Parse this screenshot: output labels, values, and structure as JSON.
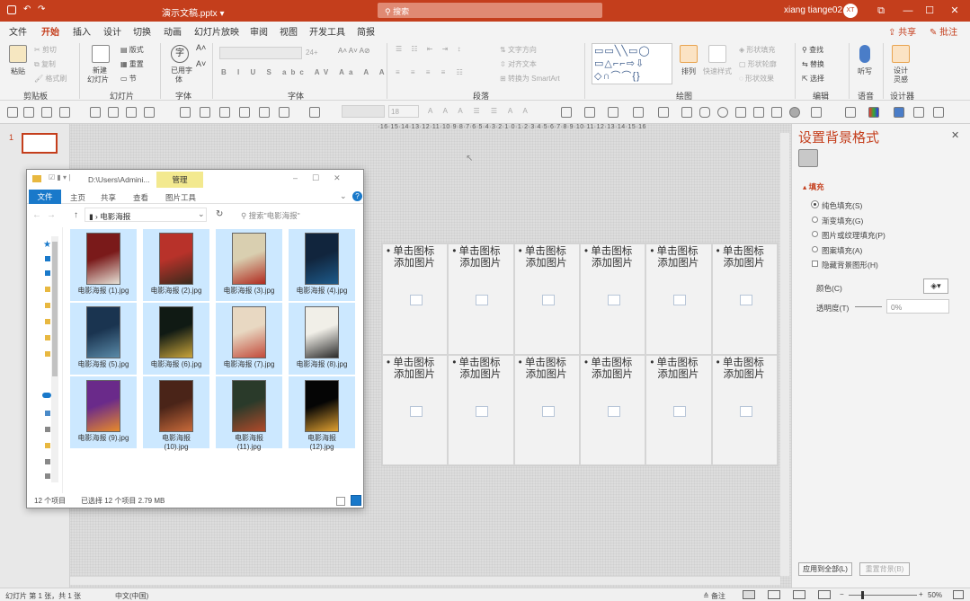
{
  "titlebar": {
    "doc_title": "演示文稿.pptx  ▾",
    "search": "搜索",
    "user": "xiang tiange02",
    "avatar": "XT",
    "min": "—",
    "max": "☐",
    "close": "✕",
    "restore": "⧉"
  },
  "tabs": [
    "文件",
    "开始",
    "插入",
    "设计",
    "切换",
    "动画",
    "幻灯片放映",
    "审阅",
    "视图",
    "开发工具",
    "简报"
  ],
  "tabs_active": "开始",
  "share": "共享",
  "comment": "批注",
  "ribbon": {
    "clipboard": {
      "label": "剪贴板",
      "paste": "粘贴",
      "cut": "剪切",
      "copy": "复制",
      "painter": "格式刷"
    },
    "slides": {
      "label": "幻灯片",
      "new": "新建",
      "new2": "幻灯片",
      "layout": "版式",
      "reset": "重置",
      "section": "节"
    },
    "font_grp": {
      "label": "字体",
      "used": "已用字",
      "used2": "体",
      "char": "字"
    },
    "font": {
      "label": "字体",
      "size": "24+"
    },
    "paragraph": {
      "label": "段落",
      "direction": "文字方向",
      "align": "对齐文本",
      "smartart": "转换为 SmartArt"
    },
    "drawing": {
      "label": "绘图",
      "arrange": "排列",
      "quick": "快速样式",
      "fill": "形状填充",
      "outline": "形状轮廓",
      "effect": "形状效果"
    },
    "editing": {
      "label": "编辑",
      "find": "查找",
      "replace": "替换",
      "select": "选择"
    },
    "voice": {
      "label": "语音",
      "dictate": "听写"
    },
    "designer": {
      "label": "设计器",
      "idea": "设计",
      "idea2": "灵感"
    }
  },
  "toolbar2": {
    "fontsize": "18"
  },
  "slide": {
    "number": "1",
    "ruler": "·16·15·14·13·12·11·10·9·8·7·6·5·4·3·2·1·0·1·2·3·4·5·6·7·8·9·10·11·12·13·14·15·16",
    "cells": [
      {
        "line1": "• 单击图标",
        "line2": "添加图片"
      },
      {
        "line1": "• 单击图标",
        "line2": "添加图片"
      },
      {
        "line1": "• 单击图标",
        "line2": "添加图片"
      },
      {
        "line1": "• 单击图标",
        "line2": "添加图片"
      },
      {
        "line1": "• 单击图标",
        "line2": "添加图片"
      },
      {
        "line1": "• 单击图标",
        "line2": "添加图片"
      },
      {
        "line1": "• 单击图标",
        "line2": "添加图片"
      },
      {
        "line1": "• 单击图标",
        "line2": "添加图片"
      },
      {
        "line1": "• 单击图标",
        "line2": "添加图片"
      },
      {
        "line1": "• 单击图标",
        "line2": "添加图片"
      },
      {
        "line1": "• 单击图标",
        "line2": "添加图片"
      },
      {
        "line1": "• 单击图标",
        "line2": "添加图片"
      }
    ]
  },
  "format_pane": {
    "title": "设置背景格式",
    "section": "▴ 填充",
    "options": [
      "纯色填充(S)",
      "渐变填充(G)",
      "图片或纹理填充(P)",
      "图案填充(A)"
    ],
    "hide": "隐藏背景图形(H)",
    "color": "颜色(C)",
    "transparency": "透明度(T)",
    "transparency_value": "0%",
    "apply_all": "应用到全部(L)",
    "reset_bg": "重置背景(B)"
  },
  "explorer": {
    "path": "D:\\Users\\Admini...",
    "manage": "管理",
    "file_tab": "文件",
    "tabs": [
      "主页",
      "共享",
      "查看",
      "图片工具"
    ],
    "address": "电影海报",
    "search": "搜索\"电影海报\"",
    "files": [
      {
        "name": "电影海报 (1).jpg",
        "c1": "#7a1a1a",
        "c2": "#e6e1d6"
      },
      {
        "name": "电影海报 (2).jpg",
        "c1": "#b8322a",
        "c2": "#3a2a1c"
      },
      {
        "name": "电影海报 (3).jpg",
        "c1": "#d9cfb0",
        "c2": "#b02a1f"
      },
      {
        "name": "电影海报 (4).jpg",
        "c1": "#11253d",
        "c2": "#1d5a8a"
      },
      {
        "name": "电影海报 (5).jpg",
        "c1": "#1a3450",
        "c2": "#5a8aa8"
      },
      {
        "name": "电影海报 (6).jpg",
        "c1": "#101a14",
        "c2": "#c9a43a"
      },
      {
        "name": "电影海报 (7).jpg",
        "c1": "#e8d8c2",
        "c2": "#c24a3a"
      },
      {
        "name": "电影海报 (8).jpg",
        "c1": "#f1efe8",
        "c2": "#2a2a2a"
      },
      {
        "name": "电影海报 (9).jpg",
        "c1": "#6a2a8a",
        "c2": "#e88a2a"
      },
      {
        "name": "电影海报\n(10).jpg",
        "c1": "#4a2418",
        "c2": "#c86a3a"
      },
      {
        "name": "电影海报\n(11).jpg",
        "c1": "#2a3a2a",
        "c2": "#b04a2a"
      },
      {
        "name": "电影海报\n(12).jpg",
        "c1": "#050505",
        "c2": "#e0a030"
      }
    ],
    "count": "12 个项目",
    "selected": "已选择 12 个项目  2.79 MB"
  },
  "status": {
    "slide": "幻灯片 第 1 张，共 1 张",
    "lang": "中文(中国)",
    "notes": "备注",
    "zoom": "50%"
  }
}
